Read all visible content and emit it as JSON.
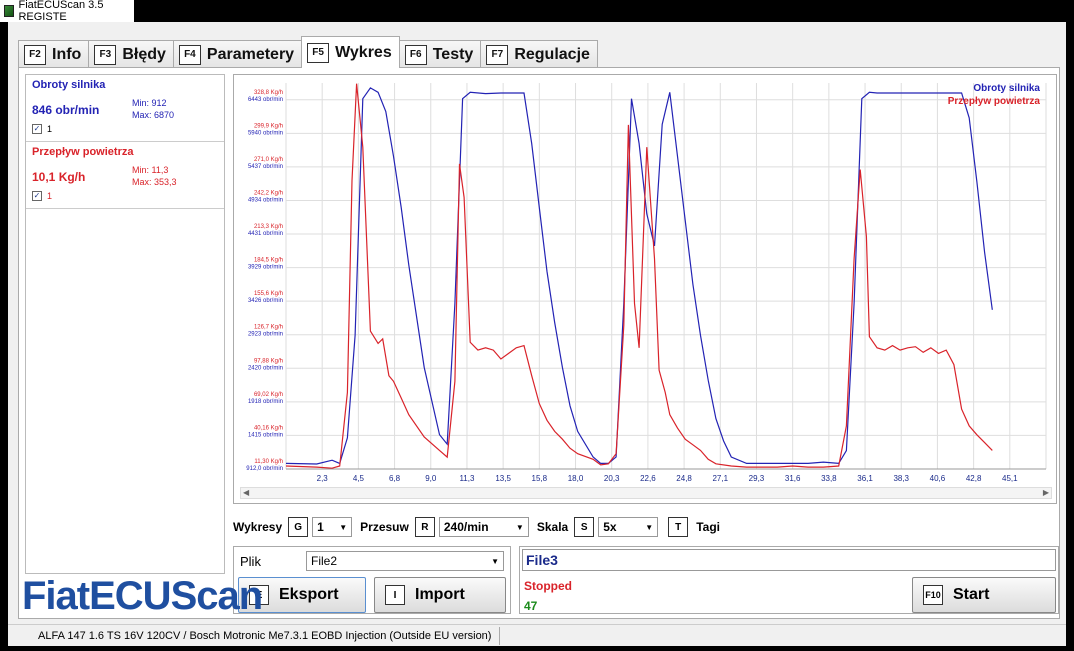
{
  "app": {
    "title": "FiatECUScan 3.5 REGISTE"
  },
  "tabs": [
    {
      "key": "F2",
      "label": "Info"
    },
    {
      "key": "F3",
      "label": "Błędy"
    },
    {
      "key": "F4",
      "label": "Parametery"
    },
    {
      "key": "F5",
      "label": "Wykres"
    },
    {
      "key": "F6",
      "label": "Testy"
    },
    {
      "key": "F7",
      "label": "Regulacje"
    }
  ],
  "sensors": [
    {
      "name": "Obroty silnika",
      "value": "846 obr/min",
      "min": "Min: 912",
      "max": "Max: 6870",
      "check": "1",
      "color": "#2323b4"
    },
    {
      "name": "Przepływ powietrza",
      "value": "10,1 Kg/h",
      "min": "Min: 11,3",
      "max": "Max: 353,3",
      "check": "1",
      "color": "#d9232a"
    }
  ],
  "chart_data": {
    "type": "line",
    "x_ticks": [
      "2,3",
      "4,5",
      "6,8",
      "9,0",
      "11,3",
      "13,5",
      "15,8",
      "18,0",
      "20,3",
      "22,6",
      "24,8",
      "27,1",
      "29,3",
      "31,6",
      "33,8",
      "36,1",
      "38,3",
      "40,6",
      "42,8",
      "45,1"
    ],
    "y_ticks_red": [
      "11,30 Kg/h",
      "40,16 Kg/h",
      "69,02 Kg/h",
      "97,88 Kg/h",
      "126,7 Kg/h",
      "155,6 Kg/h",
      "184,5 Kg/h",
      "213,3 Kg/h",
      "242,2 Kg/h",
      "271,0 Kg/h",
      "299,9 Kg/h",
      "328,8 Kg/h"
    ],
    "y_ticks_blue": [
      "912,0 obr/min",
      "1415 obr/min",
      "1918 obr/min",
      "2420 obr/min",
      "2923 obr/min",
      "3426 obr/min",
      "3929 obr/min",
      "4431 obr/min",
      "4934 obr/min",
      "5437 obr/min",
      "5940 obr/min",
      "6443 obr/min"
    ],
    "xlim": [
      0,
      49.5
    ],
    "ylim_red": [
      11.3,
      357.6
    ],
    "ylim_blue": [
      912,
      6946
    ],
    "series": [
      {
        "name": "Obroty silnika",
        "color": "#2323b4",
        "x": [
          0,
          2,
          3,
          3.5,
          4,
          4.5,
          5,
          5.5,
          6,
          6.5,
          7,
          7.5,
          8,
          9,
          10,
          10.5,
          11,
          11.5,
          12,
          13,
          14,
          15,
          15.5,
          16,
          16.5,
          17,
          17.5,
          18,
          18.5,
          19,
          20,
          20.5,
          21,
          21.5,
          22,
          22.5,
          23,
          23.5,
          24,
          24.5,
          25,
          25.5,
          26,
          26.5,
          27,
          27.5,
          28,
          28.5,
          29,
          30,
          31,
          32,
          33,
          34,
          35,
          36,
          36.5,
          37,
          37.5,
          38,
          38.5,
          39,
          40,
          41,
          42,
          43,
          44,
          44.5,
          45,
          45.5,
          46
        ],
        "y": [
          1000,
          990,
          1050,
          1000,
          1400,
          3000,
          6700,
          6870,
          6800,
          6500,
          5800,
          5000,
          4100,
          2500,
          1450,
          1300,
          3500,
          6700,
          6800,
          6780,
          6790,
          6790,
          6790,
          6000,
          5000,
          4000,
          3200,
          2500,
          1900,
          1500,
          1100,
          1000,
          1000,
          1100,
          3500,
          6700,
          6000,
          4900,
          4400,
          6300,
          6800,
          5800,
          4800,
          3800,
          3000,
          2300,
          1700,
          1350,
          1100,
          1000,
          1000,
          1000,
          1000,
          1000,
          1020,
          1000,
          1200,
          3500,
          6700,
          6800,
          6790,
          6790,
          6790,
          6790,
          6790,
          6790,
          6790,
          6400,
          5400,
          4300,
          3400
        ]
      },
      {
        "name": "Przepływ powietrza",
        "color": "#d9232a",
        "x": [
          0,
          2,
          3,
          3.5,
          4,
          4.3,
          4.6,
          5,
          5.5,
          6,
          6.3,
          6.7,
          7,
          7.5,
          8,
          9,
          10,
          10.5,
          11,
          11.3,
          11.6,
          12,
          12.5,
          13,
          13.5,
          14,
          14.5,
          15,
          15.5,
          16,
          16.5,
          17,
          17.5,
          18,
          18.5,
          19,
          20,
          20.5,
          21,
          21.5,
          22,
          22.3,
          22.7,
          23,
          23.5,
          24,
          24.3,
          24.7,
          25,
          25.5,
          26,
          26.5,
          27,
          27.5,
          28,
          29,
          30,
          31,
          32,
          33,
          34,
          35,
          36,
          36.5,
          37,
          37.4,
          37.8,
          38,
          38.5,
          39,
          39.5,
          40,
          40.5,
          41,
          41.5,
          42,
          42.5,
          43,
          43.5,
          44,
          44.5,
          45,
          45.5,
          46
        ],
        "y": [
          14,
          13,
          12,
          14,
          80,
          270,
          357,
          300,
          135,
          124,
          128,
          95,
          90,
          75,
          60,
          40,
          28,
          22,
          90,
          285,
          255,
          125,
          118,
          120,
          118,
          110,
          115,
          120,
          122,
          95,
          70,
          55,
          45,
          38,
          30,
          25,
          20,
          15,
          16,
          25,
          140,
          320,
          160,
          120,
          300,
          200,
          100,
          80,
          60,
          48,
          38,
          33,
          28,
          20,
          16,
          14,
          13,
          13,
          13,
          14,
          13,
          13,
          14,
          50,
          200,
          280,
          220,
          130,
          120,
          118,
          122,
          118,
          120,
          121,
          116,
          120,
          115,
          118,
          105,
          65,
          50,
          42,
          35,
          28
        ]
      }
    ]
  },
  "controls": {
    "wykresy_label": "Wykresy",
    "wykresy_key": "G",
    "wykresy_value": "1",
    "przesuw_label": "Przesuw",
    "przesuw_key": "R",
    "przesuw_value": "240/min",
    "skala_label": "Skala",
    "skala_key": "S",
    "skala_value": "5x",
    "tagi_key": "T",
    "tagi_label": "Tagi"
  },
  "file": {
    "label": "Plik",
    "value": "File2",
    "export_key": "E",
    "export_label": "Eksport",
    "import_key": "I",
    "import_label": "Import"
  },
  "run": {
    "file_name": "File3",
    "status": "Stopped",
    "count": "47",
    "start_key": "F10",
    "start_label": "Start"
  },
  "logo": "FiatECUScan",
  "statusbar": {
    "text": "ALFA 147 1.6 TS 16V 120CV / Bosch Motronic Me7.3.1 EOBD Injection (Outside EU version)"
  }
}
